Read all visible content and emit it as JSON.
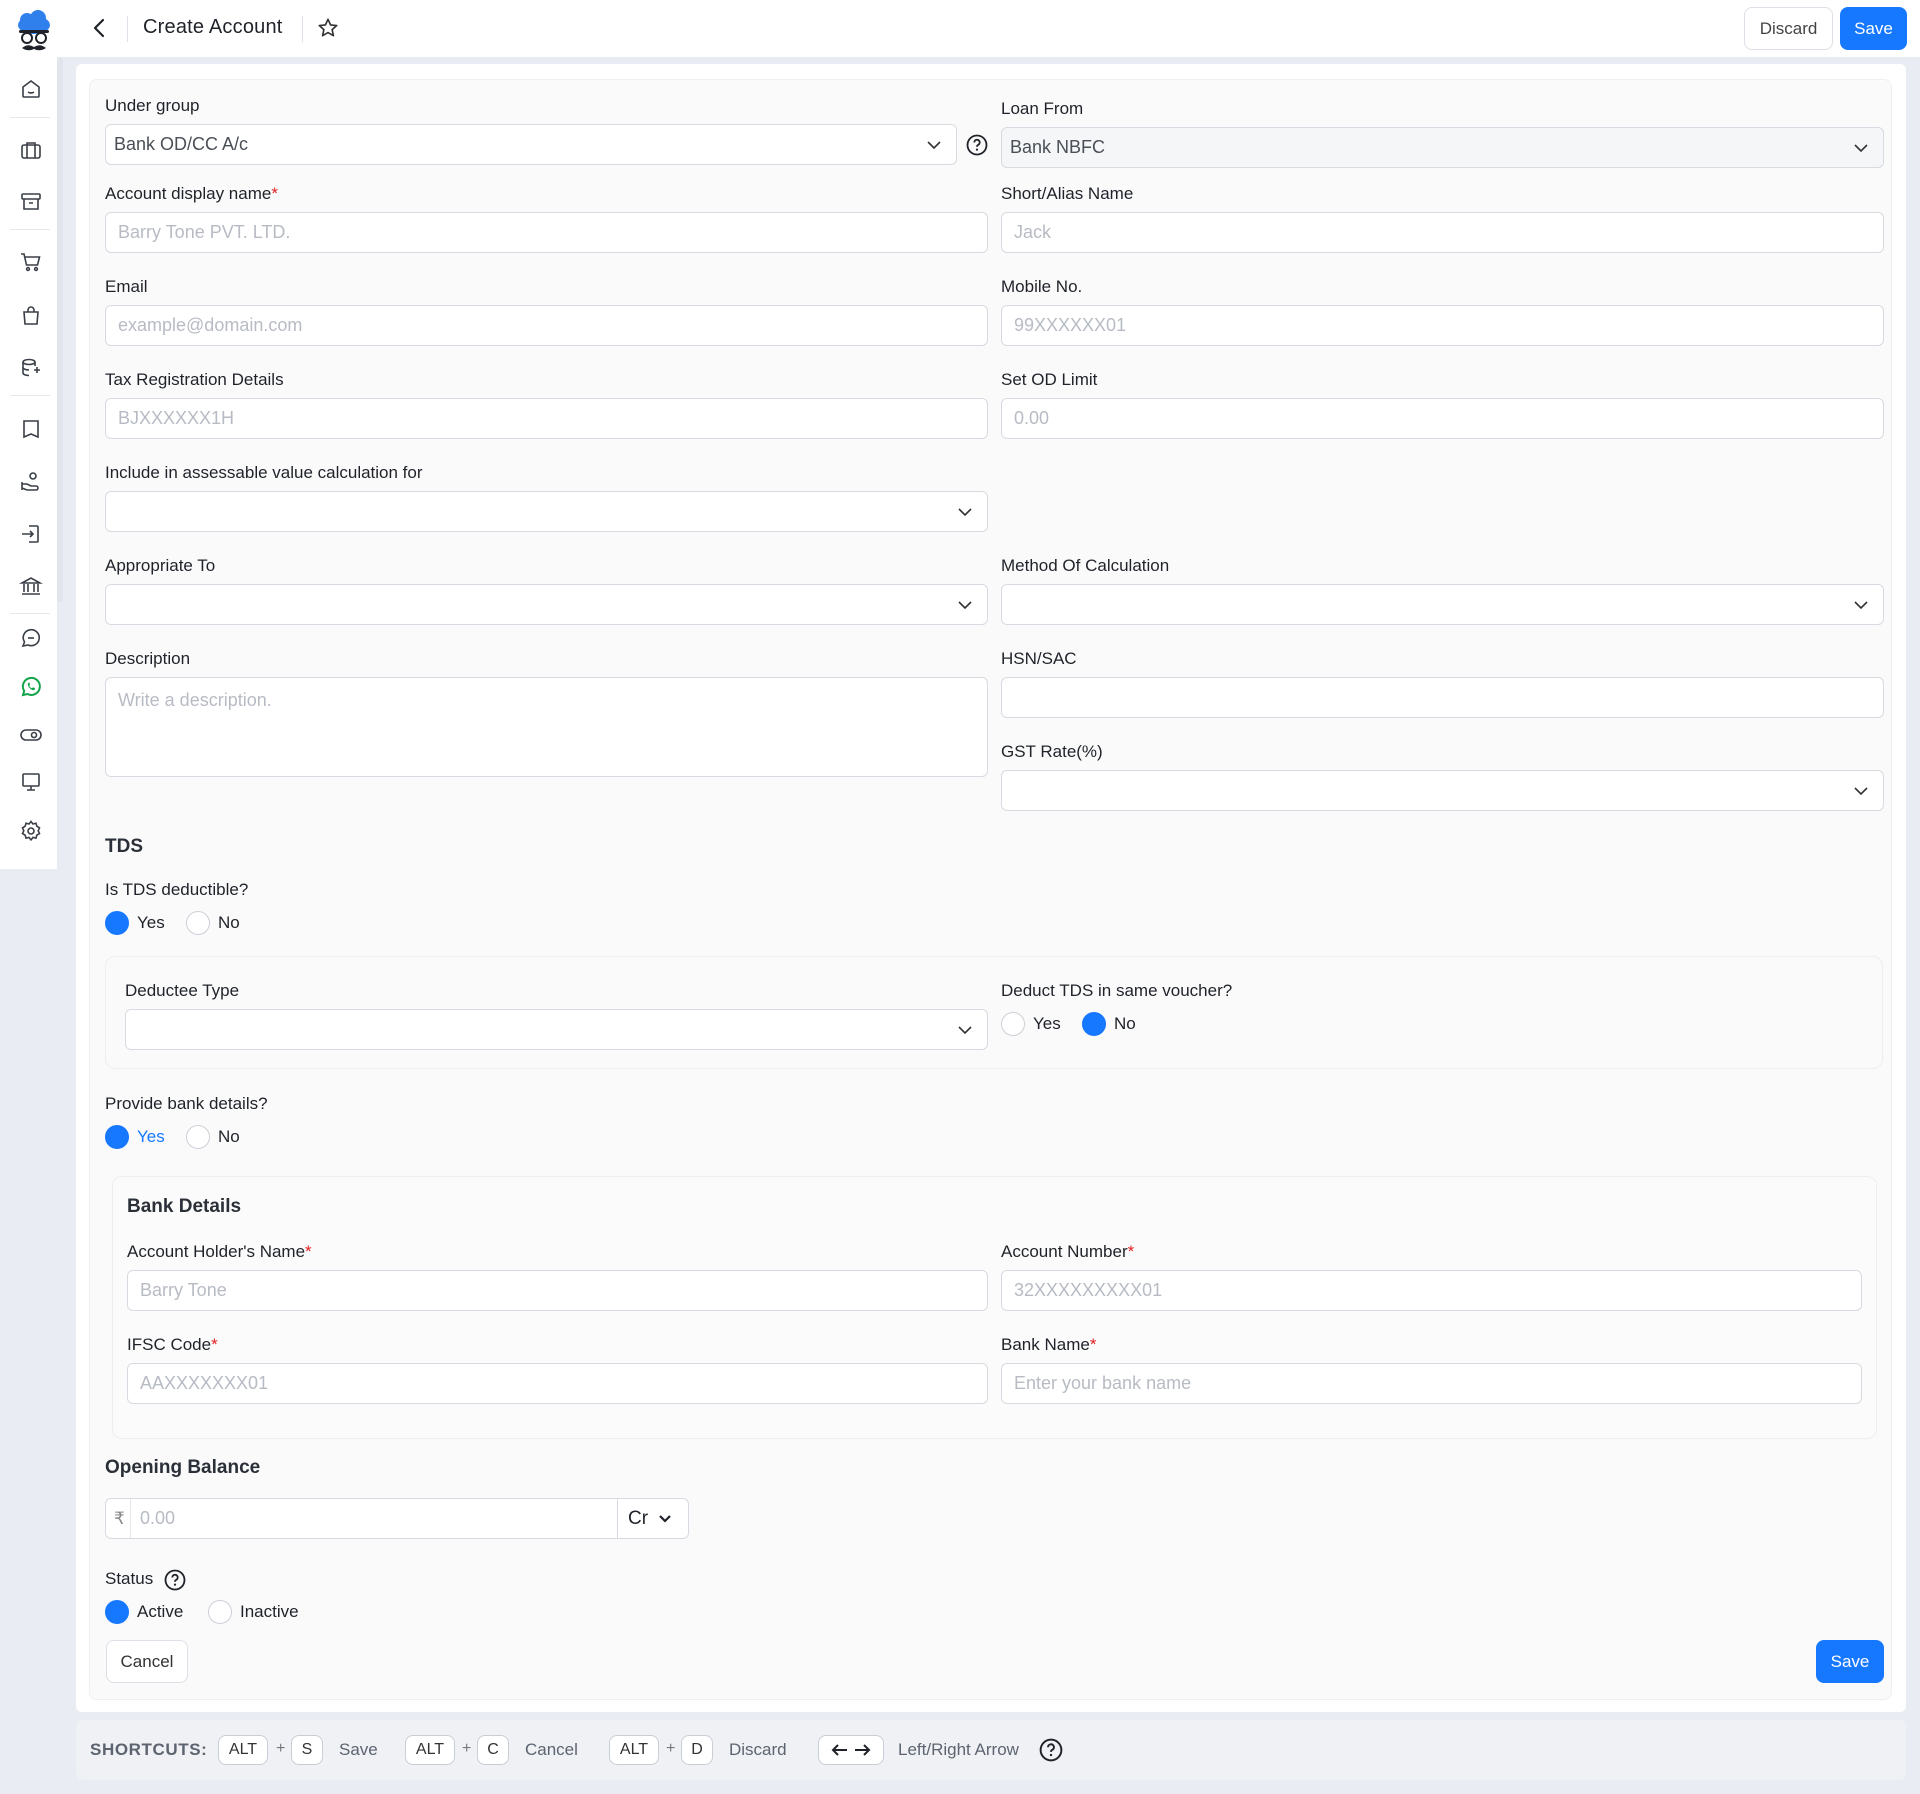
{
  "header": {
    "title": "Create Account",
    "discard_label": "Discard",
    "save_label": "Save"
  },
  "sidebar": {
    "items": [
      {
        "icon": "home-icon"
      },
      {
        "icon": "briefcase-icon"
      },
      {
        "icon": "archive-icon"
      },
      {
        "icon": "cart-icon"
      },
      {
        "icon": "shopping-bag-icon"
      },
      {
        "icon": "stack-icon"
      },
      {
        "icon": "book-icon"
      },
      {
        "icon": "hand-coins-icon"
      },
      {
        "icon": "login-icon"
      },
      {
        "icon": "bank-icon"
      },
      {
        "icon": "chat-icon"
      },
      {
        "icon": "whatsapp-icon"
      },
      {
        "icon": "toggle-icon"
      },
      {
        "icon": "monitor-icon"
      },
      {
        "icon": "settings-icon"
      }
    ]
  },
  "form": {
    "under_group": {
      "label": "Under group",
      "value": "Bank OD/CC A/c"
    },
    "loan_from": {
      "label": "Loan From",
      "value": "Bank NBFC"
    },
    "display_name": {
      "label": "Account display name",
      "required": "*",
      "placeholder": "Barry Tone PVT. LTD."
    },
    "alias": {
      "label": "Short/Alias Name",
      "placeholder": "Jack"
    },
    "email": {
      "label": "Email",
      "placeholder": "example@domain.com"
    },
    "mobile": {
      "label": "Mobile No.",
      "placeholder": "99XXXXXX01"
    },
    "tax": {
      "label": "Tax Registration Details",
      "placeholder": "BJXXXXXX1H"
    },
    "od_limit": {
      "label": "Set OD Limit",
      "placeholder": "0.00"
    },
    "assessable": {
      "label": "Include in assessable value calculation for",
      "value": ""
    },
    "appropriate": {
      "label": "Appropriate To",
      "value": ""
    },
    "method": {
      "label": "Method Of Calculation",
      "value": ""
    },
    "description": {
      "label": "Description",
      "placeholder": "Write a description."
    },
    "hsn": {
      "label": "HSN/SAC",
      "value": ""
    },
    "gst": {
      "label": "GST Rate(%)",
      "value": ""
    }
  },
  "tds": {
    "title": "TDS",
    "question": "Is TDS deductible?",
    "yes": "Yes",
    "no": "No",
    "selected": "Yes",
    "deductee_label": "Deductee Type",
    "deductee_value": "",
    "same_voucher_label": "Deduct TDS in same voucher?",
    "same_voucher_selected": "No"
  },
  "bank": {
    "question": "Provide bank details?",
    "yes": "Yes",
    "no": "No",
    "selected": "Yes",
    "title": "Bank Details",
    "holder": {
      "label": "Account Holder's Name",
      "required": "*",
      "placeholder": "Barry Tone"
    },
    "account_no": {
      "label": "Account Number",
      "required": "*",
      "placeholder": "32XXXXXXXXX01"
    },
    "ifsc": {
      "label": "IFSC Code",
      "required": "*",
      "placeholder": "AAXXXXXXX01"
    },
    "bank_name": {
      "label": "Bank Name",
      "required": "*",
      "placeholder": "Enter your bank name"
    }
  },
  "opening": {
    "title": "Opening Balance",
    "currency": "₹",
    "placeholder": "0.00",
    "type": "Cr"
  },
  "status": {
    "label": "Status",
    "active": "Active",
    "inactive": "Inactive",
    "selected": "Active"
  },
  "footer": {
    "cancel_label": "Cancel",
    "save_label": "Save"
  },
  "shortcuts": {
    "title": "SHORTCUTS:",
    "alt": "ALT",
    "plus": "+",
    "save_key": "S",
    "save_label": "Save",
    "cancel_key": "C",
    "cancel_label": "Cancel",
    "discard_key": "D",
    "discard_label": "Discard",
    "arrows_label": "Left/Right Arrow"
  },
  "colors": {
    "accent": "#1677ff",
    "required": "#e02020"
  }
}
